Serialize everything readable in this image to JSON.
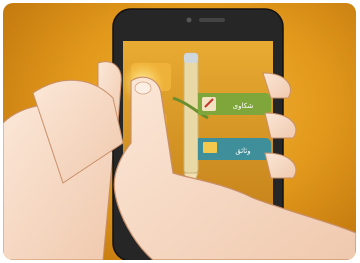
{
  "scene": {
    "description_free": true,
    "palette": {
      "background": "#e39a1c",
      "phone_body": "#2a2a2a",
      "screen": "#d9961f",
      "skin": "#f7dcc8",
      "button_green": "#7fa63a",
      "button_teal": "#3f8f9a",
      "pencil": "#e7d7a3"
    },
    "buttons": [
      {
        "label": "شكاوى",
        "icon": "edit-icon",
        "color": "#7fa63a"
      },
      {
        "label": "وثائق",
        "icon": "folder-icon",
        "color": "#3f8f9a"
      }
    ]
  }
}
